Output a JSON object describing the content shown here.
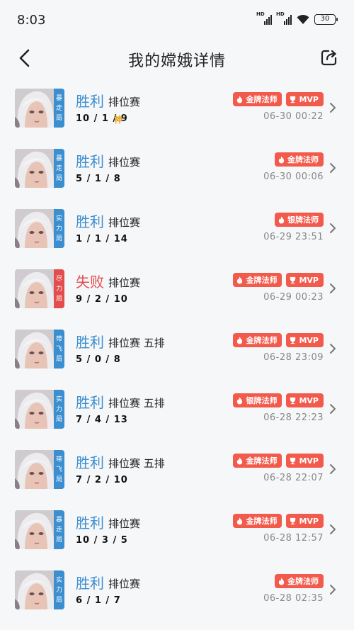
{
  "status": {
    "time": "8:03",
    "sim1_label": "HD",
    "sim2_label": "HD",
    "battery": "30"
  },
  "header": {
    "title": "我的嫦娥详情",
    "back_icon": "chevron-left-icon",
    "share_icon": "share-export-icon"
  },
  "colors": {
    "win": "#3b8ecf",
    "lose": "#e34d4d",
    "badge": "#f25a4c",
    "god": "#e5a21a",
    "tag_blue": "#3b8ecf",
    "tag_red": "#e34d4d"
  },
  "matches": [
    {
      "mode_tag": [
        "暴",
        "走",
        "局"
      ],
      "tag_color": "blue",
      "result": "胜利",
      "outcome": "win",
      "match_type": "排位赛",
      "kda": "10 / 1 / 9",
      "god": "神",
      "badges": [
        "金牌法师",
        "MVP"
      ],
      "time": "06-30 00:22"
    },
    {
      "mode_tag": [
        "暴",
        "走",
        "局"
      ],
      "tag_color": "blue",
      "result": "胜利",
      "outcome": "win",
      "match_type": "排位赛",
      "kda": "5 / 1 / 8",
      "god": "",
      "badges": [
        "金牌法师"
      ],
      "time": "06-30 00:06"
    },
    {
      "mode_tag": [
        "实",
        "力",
        "局"
      ],
      "tag_color": "blue",
      "result": "胜利",
      "outcome": "win",
      "match_type": "排位赛",
      "kda": "1 / 1 / 14",
      "god": "",
      "badges": [
        "银牌法师"
      ],
      "time": "06-29 23:51"
    },
    {
      "mode_tag": [
        "尽",
        "力",
        "局"
      ],
      "tag_color": "red",
      "result": "失败",
      "outcome": "lose",
      "match_type": "排位赛",
      "kda": "9 / 2 / 10",
      "god": "",
      "badges": [
        "金牌法师",
        "MVP"
      ],
      "time": "06-29 00:23"
    },
    {
      "mode_tag": [
        "带",
        "飞",
        "局"
      ],
      "tag_color": "blue",
      "result": "胜利",
      "outcome": "win",
      "match_type": "排位赛 五排",
      "kda": "5 / 0 / 8",
      "god": "",
      "badges": [
        "金牌法师",
        "MVP"
      ],
      "time": "06-28 23:09"
    },
    {
      "mode_tag": [
        "实",
        "力",
        "局"
      ],
      "tag_color": "blue",
      "result": "胜利",
      "outcome": "win",
      "match_type": "排位赛 五排",
      "kda": "7 / 4 / 13",
      "god": "",
      "badges": [
        "银牌法师",
        "MVP"
      ],
      "time": "06-28 22:23"
    },
    {
      "mode_tag": [
        "带",
        "飞",
        "局"
      ],
      "tag_color": "blue",
      "result": "胜利",
      "outcome": "win",
      "match_type": "排位赛 五排",
      "kda": "7 / 2 / 10",
      "god": "",
      "badges": [
        "金牌法师",
        "MVP"
      ],
      "time": "06-28 22:07"
    },
    {
      "mode_tag": [
        "暴",
        "走",
        "局"
      ],
      "tag_color": "blue",
      "result": "胜利",
      "outcome": "win",
      "match_type": "排位赛",
      "kda": "10 / 3 / 5",
      "god": "",
      "badges": [
        "金牌法师",
        "MVP"
      ],
      "time": "06-28 12:57"
    },
    {
      "mode_tag": [
        "实",
        "力",
        "局"
      ],
      "tag_color": "blue",
      "result": "胜利",
      "outcome": "win",
      "match_type": "排位赛",
      "kda": "6 / 1 / 7",
      "god": "",
      "badges": [
        "金牌法师"
      ],
      "time": "06-28 02:35"
    }
  ]
}
